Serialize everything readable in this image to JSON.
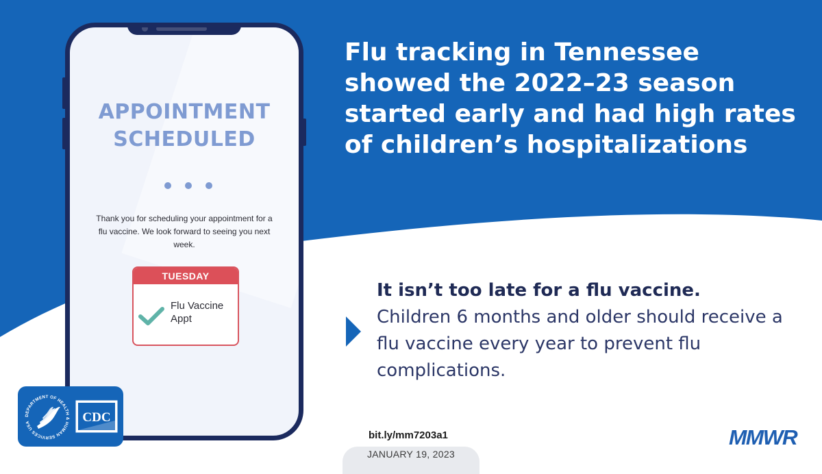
{
  "colors": {
    "blue_background": "#1565b8",
    "phone_frame": "#1b2a5e",
    "appointment_title": "#7f9bd2",
    "calendar_red": "#dc5059",
    "check_teal": "#5fb3a8",
    "message_navy": "#1f2a55",
    "mmwr_blue": "#1f5fb2"
  },
  "phone": {
    "appointment_title_line1": "APPOINTMENT",
    "appointment_title_line2": "SCHEDULED",
    "thank_you_message": "Thank you for scheduling your appointment for a flu vaccine. We look forward to seeing you next week.",
    "calendar": {
      "day": "TUESDAY",
      "entry_line1": "Flu Vaccine",
      "entry_line2": "Appt",
      "icon": "checkmark-icon"
    }
  },
  "headline": "Flu tracking in Tennessee showed the 2022–23 season started early and had high rates of children’s hospitalizations",
  "message": {
    "bold": "It isn’t too late for a flu vaccine.",
    "body": "Children 6 months and older should receive a flu vaccine every year to prevent flu complications.",
    "icon": "chevron-right-icon"
  },
  "footer": {
    "link": "bit.ly/mm7203a1",
    "date": "JANUARY 19, 2023",
    "publication": "MMWR",
    "logos": {
      "hhs_seal_text": "DEPARTMENT OF HEALTH & HUMAN SERVICES USA",
      "cdc": "CDC"
    }
  }
}
